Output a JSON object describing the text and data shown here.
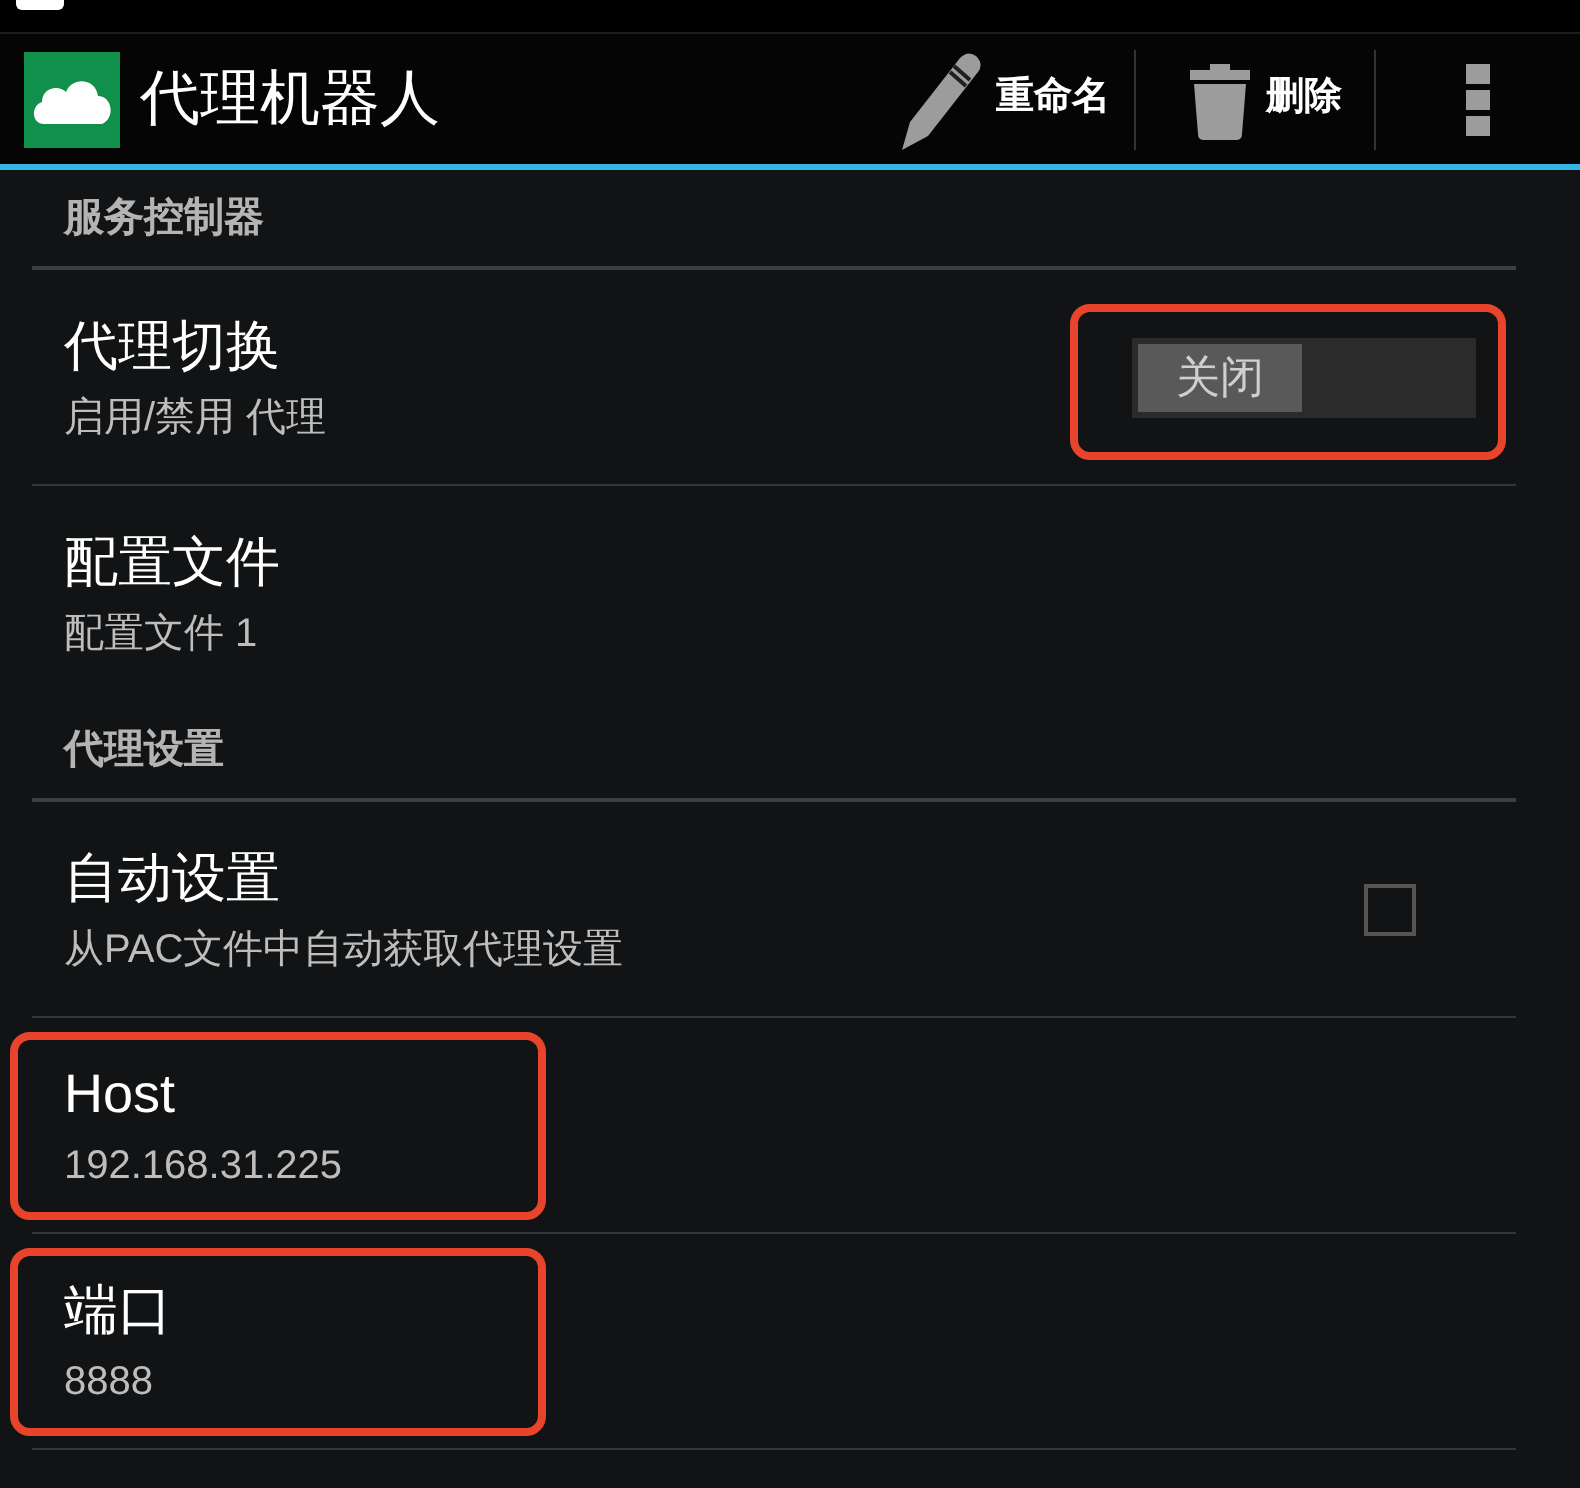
{
  "action_bar": {
    "title": "代理机器人",
    "actions": [
      {
        "kind": "edit",
        "label": "重命名"
      },
      {
        "kind": "delete",
        "label": "删除"
      }
    ]
  },
  "sections": [
    {
      "title": "服务控制器",
      "items": [
        {
          "kind": "toggle",
          "title": "代理切换",
          "summary": "启用/禁用 代理",
          "switch_label": "关闭",
          "on": false,
          "highlighted": true
        },
        {
          "kind": "text",
          "title": "配置文件",
          "summary": "配置文件 1",
          "highlighted": false
        }
      ]
    },
    {
      "title": "代理设置",
      "items": [
        {
          "kind": "checkbox",
          "title": "自动设置",
          "summary": "从PAC文件中自动获取代理设置",
          "checked": false,
          "highlighted": false
        },
        {
          "kind": "text",
          "title": "Host",
          "summary": "192.168.31.225",
          "highlighted": true
        },
        {
          "kind": "text",
          "title": "端口",
          "summary": "8888",
          "highlighted": true
        }
      ]
    }
  ]
}
